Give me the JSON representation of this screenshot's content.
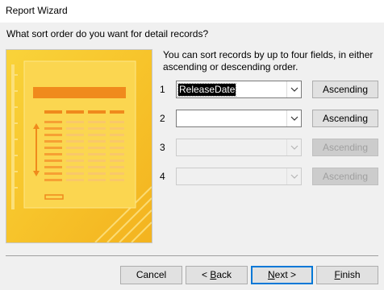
{
  "window": {
    "title": "Report Wizard"
  },
  "question": "What sort order do you want for detail records?",
  "instructions": "You can sort records by up to four fields, in either ascending or descending order.",
  "sort_rows": [
    {
      "number": "1",
      "field_value": "ReleaseDate",
      "order_label": "Ascending",
      "enabled": true
    },
    {
      "number": "2",
      "field_value": "",
      "order_label": "Ascending",
      "enabled": true
    },
    {
      "number": "3",
      "field_value": "",
      "order_label": "Ascending",
      "enabled": false
    },
    {
      "number": "4",
      "field_value": "",
      "order_label": "Ascending",
      "enabled": false
    }
  ],
  "buttons": {
    "cancel": "Cancel",
    "back_prefix": "< ",
    "back_key": "B",
    "back_rest": "ack",
    "next_key": "N",
    "next_rest": "ext >",
    "finish_key": "F",
    "finish_rest": "inish"
  },
  "icons": {
    "dropdown": "chevron-down-icon"
  },
  "colors": {
    "illustration_bg": "#f7c42b",
    "illustration_accent": "#f08a1c",
    "default_button_border": "#0078d7"
  }
}
